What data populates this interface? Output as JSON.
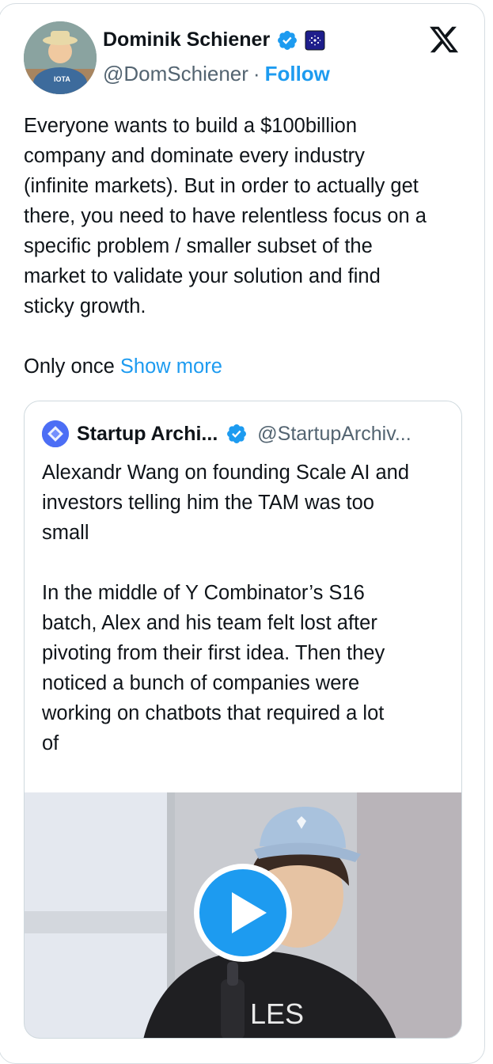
{
  "tweet": {
    "author_name": "Dominik Schiener",
    "author_handle": "@DomSchiener",
    "separator": "·",
    "follow_label": "Follow",
    "avatar_caption": "IOTA",
    "body": "Everyone wants to build a $100billion\ncompany and dominate every industry\n(infinite markets). But in order to actually get\nthere, you need to have relentless focus on a\nspecific problem / smaller subset of the\nmarket to validate your solution and find\nsticky growth.",
    "continuation": "Only once",
    "show_more_label": "Show more",
    "brand_color": "#1d9bf0"
  },
  "quote": {
    "author_name": "Startup Archi...",
    "author_handle": "@StartupArchiv...",
    "body": "Alexandr Wang on founding Scale AI and\ninvestors telling him the TAM was too\nsmall\n\nIn the middle of Y Combinator’s S16\nbatch, Alex and his team felt lost after\npivoting from their first idea. Then they\nnoticed a bunch of companies were\nworking on chatbots that required a lot\nof",
    "video_shirt_text": "LES"
  },
  "icons": {
    "verified": "verified-badge-icon",
    "affiliate": "affiliate-badge-icon",
    "platform": "x-logo-icon",
    "play": "play-icon"
  }
}
